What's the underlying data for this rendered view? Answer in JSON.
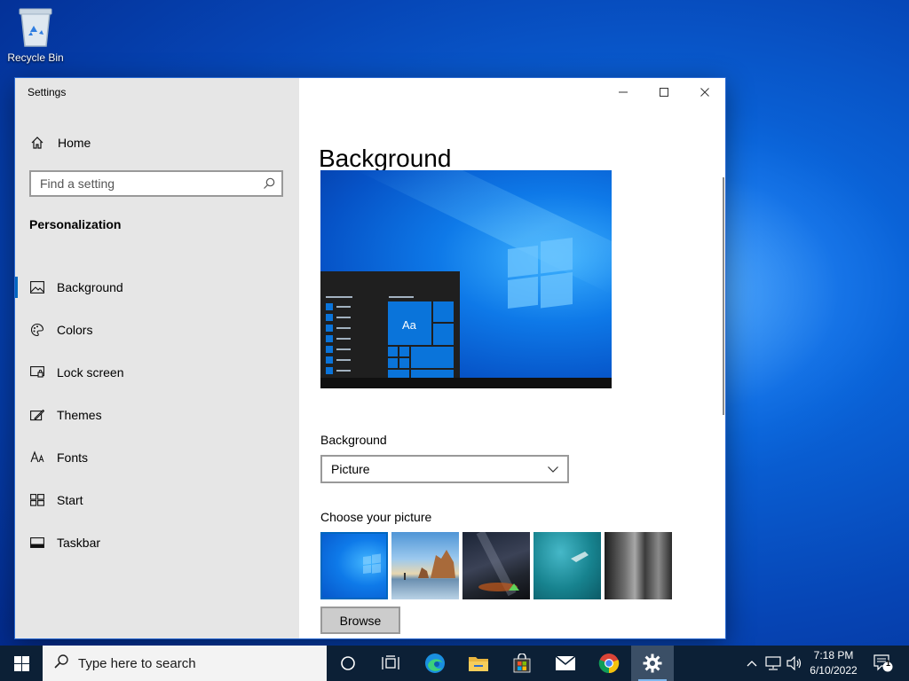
{
  "desktop": {
    "icons": [
      {
        "label": "Recycle Bin",
        "icon": "recycle-bin-icon"
      }
    ]
  },
  "window": {
    "title": "Settings",
    "controls": {
      "minimize": "minimize-icon",
      "maximize": "maximize-icon",
      "close": "close-icon"
    }
  },
  "sidebar": {
    "home_label": "Home",
    "search_placeholder": "Find a setting",
    "section_title": "Personalization",
    "items": [
      {
        "label": "Background",
        "icon": "picture-icon",
        "active": true
      },
      {
        "label": "Colors",
        "icon": "palette-icon",
        "active": false
      },
      {
        "label": "Lock screen",
        "icon": "lock-screen-icon",
        "active": false
      },
      {
        "label": "Themes",
        "icon": "themes-icon",
        "active": false
      },
      {
        "label": "Fonts",
        "icon": "fonts-icon",
        "active": false
      },
      {
        "label": "Start",
        "icon": "start-icon",
        "active": false
      },
      {
        "label": "Taskbar",
        "icon": "taskbar-icon",
        "active": false
      }
    ]
  },
  "main": {
    "page_title": "Background",
    "preview": {
      "tile_text": "Aa"
    },
    "background_label": "Background",
    "background_value": "Picture",
    "choose_label": "Choose your picture",
    "pictures": [
      "windows-blue",
      "beach-rocks",
      "night-sky-tent",
      "underwater-swimmer",
      "rock-cliff"
    ],
    "browse_label": "Browse"
  },
  "taskbar": {
    "search_placeholder": "Type here to search",
    "apps": [
      "task-view",
      "edge",
      "file-explorer",
      "store",
      "mail",
      "chrome",
      "settings"
    ],
    "active_app": "settings",
    "clock": {
      "time": "7:18 PM",
      "date": "6/10/2022"
    },
    "notification_count": "1"
  },
  "colors": {
    "accent": "#0067c0",
    "sidebar_bg": "#e6e6e6",
    "taskbar_bg": "#0c2036"
  }
}
